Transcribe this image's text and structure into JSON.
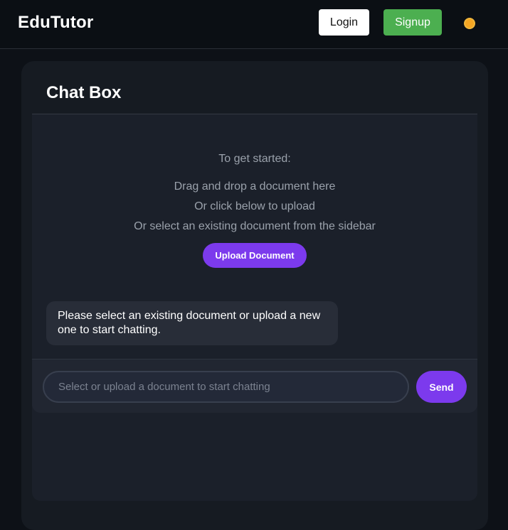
{
  "header": {
    "brand": "EduTutor",
    "login_label": "Login",
    "signup_label": "Signup",
    "theme_icon": "sun-icon"
  },
  "chat": {
    "title": "Chat Box",
    "instructions": {
      "heading": "To get started:",
      "lines": [
        "Drag and drop a document here",
        "Or click below to upload",
        "Or select an existing document from the sidebar"
      ]
    },
    "upload_label": "Upload Document",
    "message": "Please select an existing document or upload a new one to start chatting.",
    "input_placeholder": "Select or upload a document to start chatting",
    "send_label": "Send"
  },
  "colors": {
    "accent": "#7c3aed",
    "signup": "#4caf50",
    "background": "#0d1117"
  }
}
